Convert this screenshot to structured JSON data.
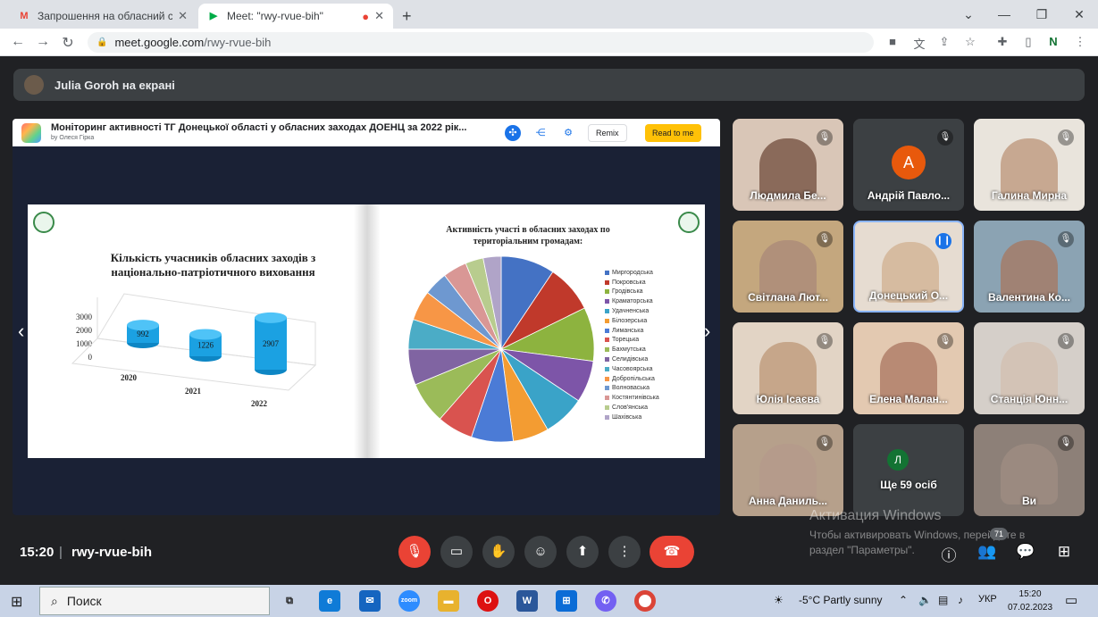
{
  "browser": {
    "tabs": [
      {
        "title": "Запрошення на обласний семі",
        "favicon": "gmail-icon",
        "active": false
      },
      {
        "title": "Meet: \"rwy-rvue-bih\"",
        "favicon": "meet-icon",
        "active": true
      }
    ],
    "new_tab": "+",
    "url_host": "meet.google.com",
    "url_path": "/rwy-rvue-bih",
    "profile_initial": "N"
  },
  "meet": {
    "presenting_banner": "Julia Goroh на екрані",
    "presentation": {
      "title": "Моніторинг активності ТГ Донецької області у обласних заходах ДОЕНЦ за 2022 рік...",
      "author": "by Олеся Гірка",
      "remix_label": "Remix",
      "read_label": "Read to me",
      "bar_chart_title": "Кількість учасників обласних заходів з національно-патріотичного виховання",
      "pie_chart_title": "Активність участі в обласних заходах по територіальним громадам:"
    },
    "participants": [
      {
        "name": "Людмила Бе...",
        "muted": true,
        "avatar": null
      },
      {
        "name": "Андрій Павло...",
        "muted": true,
        "avatar": "А"
      },
      {
        "name": "Галина Мирна",
        "muted": true,
        "avatar": null
      },
      {
        "name": "Світлана Лют...",
        "muted": true,
        "avatar": null
      },
      {
        "name": "Донецький О...",
        "muted": false,
        "avatar": null
      },
      {
        "name": "Валентина Ко...",
        "muted": true,
        "avatar": null
      },
      {
        "name": "Юлія Ісаєва",
        "muted": true,
        "avatar": null
      },
      {
        "name": "Елена Малан...",
        "muted": true,
        "avatar": null
      },
      {
        "name": "Станція Юнн...",
        "muted": true,
        "avatar": null
      },
      {
        "name": "Анна Даниль...",
        "muted": true,
        "avatar": null
      },
      {
        "name": "Ще 59 осіб",
        "muted": false,
        "avatar": "Л"
      },
      {
        "name": "Ви",
        "muted": true,
        "avatar": null
      }
    ],
    "time": "15:20",
    "meeting_code": "rwy-rvue-bih",
    "people_count": "71",
    "watermark_title": "Активация Windows",
    "watermark_text": "Чтобы активировать Windows, перейдите в раздел \"Параметры\"."
  },
  "taskbar": {
    "search_placeholder": "Поиск",
    "weather": "-5°C  Partly sunny",
    "language": "УКР",
    "clock_time": "15:20",
    "clock_date": "07.02.2023"
  },
  "chart_data": [
    {
      "type": "bar",
      "title": "Кількість учасників обласних заходів з національно-патріотичного виховання",
      "categories": [
        "2020",
        "2021",
        "2022"
      ],
      "values": [
        992,
        1226,
        2907
      ],
      "yticks": [
        "3000",
        "2000",
        "1000",
        "0"
      ],
      "ylim": [
        0,
        3000
      ],
      "color": "#1ba1e2"
    },
    {
      "type": "pie",
      "title": "Активність участі в обласних заходах по територіальним громадам:",
      "labels": [
        "Миргородська",
        "Покровська",
        "Гродівська",
        "Краматорська",
        "Удачненська",
        "Білозерська",
        "Лиманська",
        "Торецька",
        "Бахмутська",
        "Селидівська",
        "Часовоярська",
        "Добропільська",
        "Волноваська",
        "Костянтинівська",
        "Слов'янська",
        "Шахівська"
      ],
      "values": [
        9,
        8,
        9,
        7,
        7,
        6,
        7,
        6,
        7,
        6,
        5,
        5,
        4,
        4,
        3,
        3
      ],
      "colors": [
        "#4472c4",
        "#c0392b",
        "#8db33f",
        "#7d55a8",
        "#3aa3c8",
        "#f39c32",
        "#4b7bd6",
        "#d9534f",
        "#9bbb59",
        "#8064a2",
        "#4bacc6",
        "#f79646",
        "#6e98d0",
        "#d99795",
        "#b8cc8e",
        "#b0a4c8"
      ],
      "legend": "right"
    }
  ]
}
